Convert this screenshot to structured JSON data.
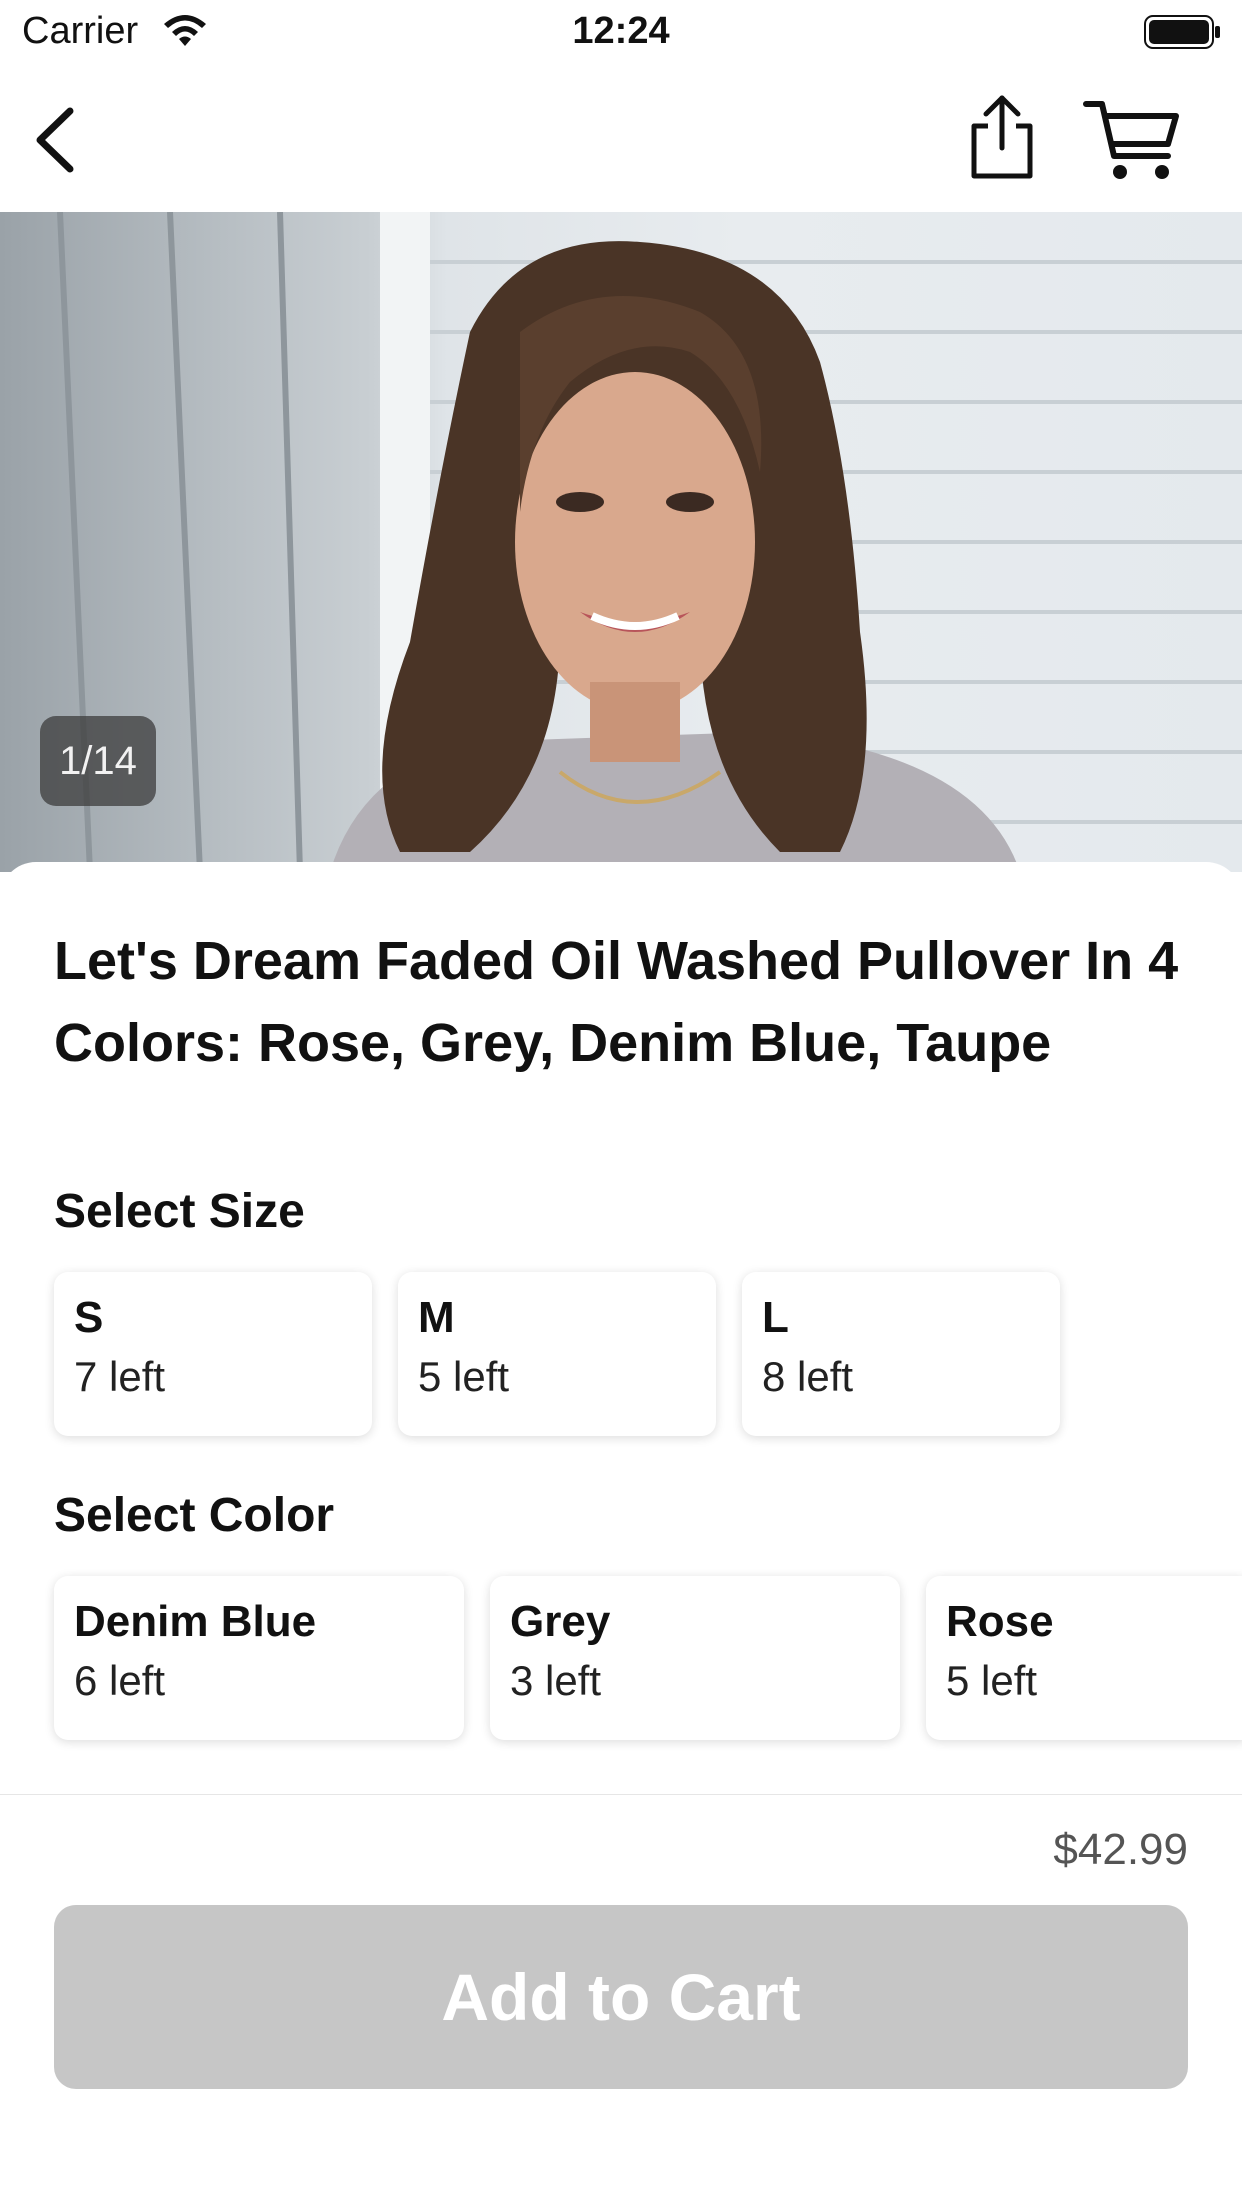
{
  "status_bar": {
    "carrier": "Carrier",
    "time": "12:24"
  },
  "nav": {
    "back_icon": "chevron-left-icon",
    "share_icon": "share-icon",
    "cart_icon": "cart-icon"
  },
  "hero": {
    "counter": "1/14"
  },
  "product": {
    "title": "Let's Dream Faded Oil Washed Pullover In 4 Colors: Rose, Grey, Denim Blue, Taupe",
    "size_label": "Select Size",
    "sizes": [
      {
        "name": "S",
        "stock": "7 left"
      },
      {
        "name": "M",
        "stock": "5 left"
      },
      {
        "name": "L",
        "stock": "8 left"
      }
    ],
    "color_label": "Select Color",
    "colors": [
      {
        "name": "Denim Blue",
        "stock": "6 left"
      },
      {
        "name": "Grey",
        "stock": "3 left"
      },
      {
        "name": "Rose",
        "stock": "5 left"
      }
    ]
  },
  "footer": {
    "price": "$42.99",
    "add_to_cart": "Add to Cart"
  },
  "colors": {
    "button_disabled": "#c6c6c6",
    "counter_bg": "#3c3c3c"
  }
}
